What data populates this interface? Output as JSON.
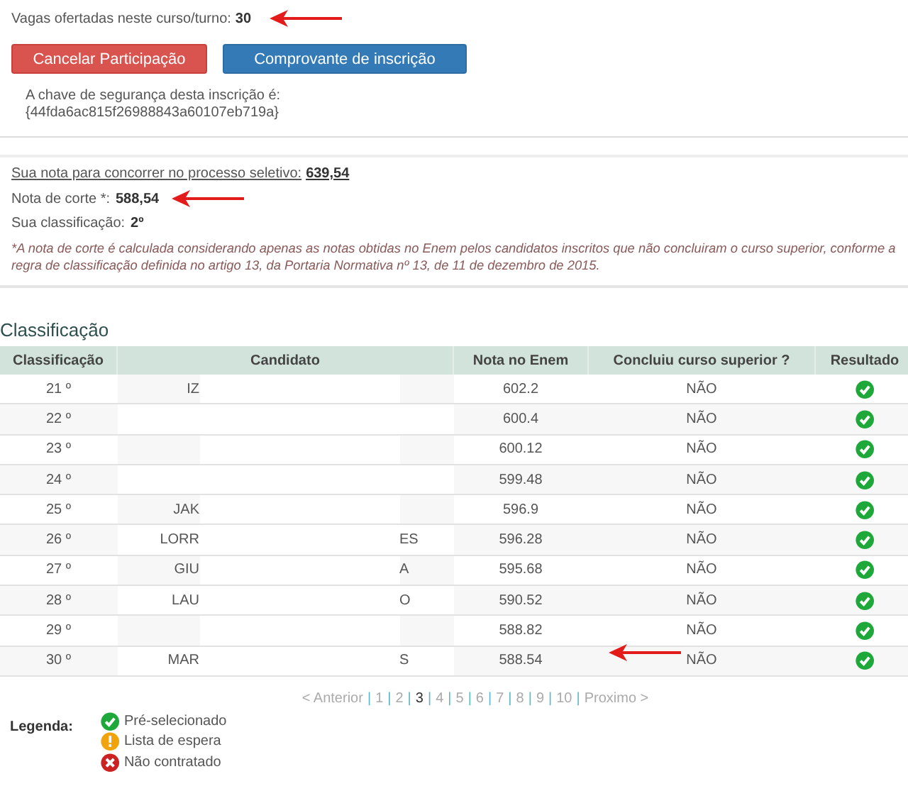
{
  "vacancies": {
    "label": "Vagas ofertadas neste curso/turno:",
    "value": "30",
    "marked": true
  },
  "buttons": [
    {
      "label": "Cancelar Participação",
      "kind": "danger"
    },
    {
      "label": "Comprovante de inscrição",
      "kind": "primary"
    }
  ],
  "security_key": {
    "label": "A chave de segurança desta inscrição é:",
    "value": "{44fda6ac815f26988843a60107eb719a}"
  },
  "summary": [
    {
      "label": "Sua nota para concorrer no processo seletivo:",
      "value": "639,54",
      "kind": "underlined",
      "marked": false
    },
    {
      "label": "Nota de corte *:",
      "value": "588,54",
      "kind": "plain",
      "marked": true
    },
    {
      "label": "Sua classificação:",
      "value": "2º",
      "kind": "plain",
      "marked": false
    }
  ],
  "note": "*A nota de corte é calculada considerando apenas as notas obtidas no Enem pelos candidatos inscritos que não concluiram o curso superior, conforme a regra de classificação definida no artigo 13, da Portaria Normativa nº 13, de 11 de dezembro de 2015.",
  "ranking": {
    "title": "Classificação",
    "columns": [
      "Classificação",
      "Candidato",
      "Nota no Enem",
      "Concluiu curso superior ?",
      "Resultado"
    ],
    "rows": [
      {
        "position": "21 º",
        "candidate_start": "IZ",
        "candidate_end": "",
        "score": "602.2",
        "graduated": "NÃO",
        "marked": false
      },
      {
        "position": "22 º",
        "candidate_start": "",
        "candidate_end": "",
        "score": "600.4",
        "graduated": "NÃO",
        "marked": false
      },
      {
        "position": "23 º",
        "candidate_start": "",
        "candidate_end": "",
        "score": "600.12",
        "graduated": "NÃO",
        "marked": false
      },
      {
        "position": "24 º",
        "candidate_start": "",
        "candidate_end": "",
        "score": "599.48",
        "graduated": "NÃO",
        "marked": false
      },
      {
        "position": "25 º",
        "candidate_start": "JAK",
        "candidate_end": "",
        "score": "596.9",
        "graduated": "NÃO",
        "marked": false
      },
      {
        "position": "26 º",
        "candidate_start": "LORR",
        "candidate_end": "ES",
        "score": "596.28",
        "graduated": "NÃO",
        "marked": false
      },
      {
        "position": "27 º",
        "candidate_start": "GIU",
        "candidate_end": "A",
        "score": "595.68",
        "graduated": "NÃO",
        "marked": false
      },
      {
        "position": "28 º",
        "candidate_start": "LAU",
        "candidate_end": "O",
        "score": "590.52",
        "graduated": "NÃO",
        "marked": false
      },
      {
        "position": "29 º",
        "candidate_start": "",
        "candidate_end": "",
        "score": "588.82",
        "graduated": "NÃO",
        "marked": false
      },
      {
        "position": "30 º",
        "candidate_start": "MAR",
        "candidate_end": "S",
        "score": "588.54",
        "graduated": "NÃO",
        "marked": true
      }
    ]
  },
  "pagination": {
    "previous": "< Anterior",
    "next": "Proximo >",
    "separator": "|",
    "pages": [
      {
        "label": "1",
        "selected": false
      },
      {
        "label": "2",
        "selected": false
      },
      {
        "label": "3",
        "selected": true
      },
      {
        "label": "4",
        "selected": false
      },
      {
        "label": "5",
        "selected": false
      },
      {
        "label": "6",
        "selected": false
      },
      {
        "label": "7",
        "selected": false
      },
      {
        "label": "8",
        "selected": false
      },
      {
        "label": "9",
        "selected": false
      },
      {
        "label": "10",
        "selected": false
      }
    ]
  },
  "legend": {
    "title": "Legenda:",
    "items": [
      {
        "label": "Pré-selecionado",
        "kind": "check"
      },
      {
        "label": "Lista de espera",
        "kind": "warning"
      },
      {
        "label": "Não contratado",
        "kind": "cross"
      }
    ]
  }
}
